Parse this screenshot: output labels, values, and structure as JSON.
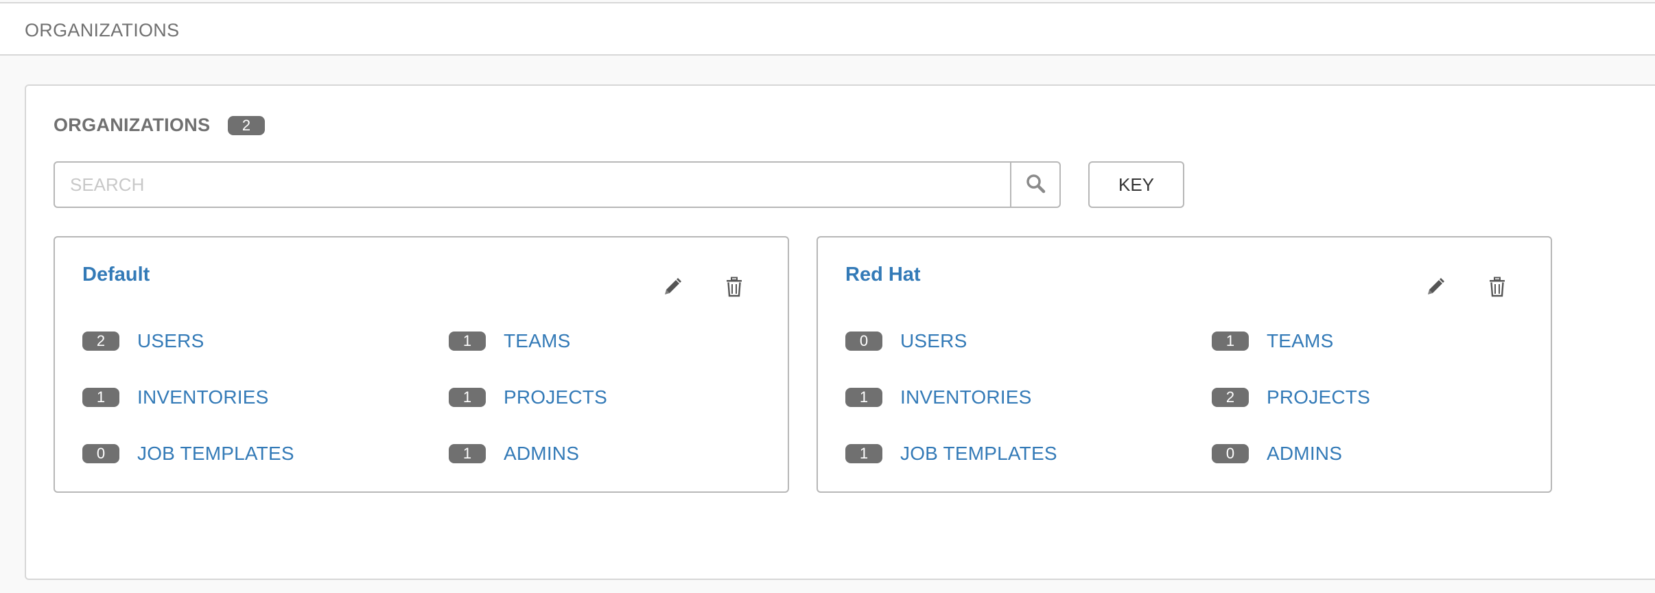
{
  "breadcrumb": {
    "current": "ORGANIZATIONS"
  },
  "panel": {
    "title": "ORGANIZATIONS",
    "count": "2"
  },
  "search": {
    "placeholder": "SEARCH",
    "value": ""
  },
  "key_button": {
    "label": "KEY"
  },
  "organizations": [
    {
      "name": "Default",
      "users": {
        "count": "2",
        "label": "USERS"
      },
      "teams": {
        "count": "1",
        "label": "TEAMS"
      },
      "inventories": {
        "count": "1",
        "label": "INVENTORIES"
      },
      "projects": {
        "count": "1",
        "label": "PROJECTS"
      },
      "job_templates": {
        "count": "0",
        "label": "JOB TEMPLATES"
      },
      "admins": {
        "count": "1",
        "label": "ADMINS"
      }
    },
    {
      "name": "Red Hat",
      "users": {
        "count": "0",
        "label": "USERS"
      },
      "teams": {
        "count": "1",
        "label": "TEAMS"
      },
      "inventories": {
        "count": "1",
        "label": "INVENTORIES"
      },
      "projects": {
        "count": "2",
        "label": "PROJECTS"
      },
      "job_templates": {
        "count": "1",
        "label": "JOB TEMPLATES"
      },
      "admins": {
        "count": "0",
        "label": "ADMINS"
      }
    }
  ],
  "icons": {
    "search": "search-icon",
    "edit": "pencil-icon",
    "delete": "trash-icon"
  },
  "colors": {
    "link": "#337ab7",
    "badge": "#707070",
    "border": "#b7b7b7",
    "muted_text": "#707070"
  }
}
